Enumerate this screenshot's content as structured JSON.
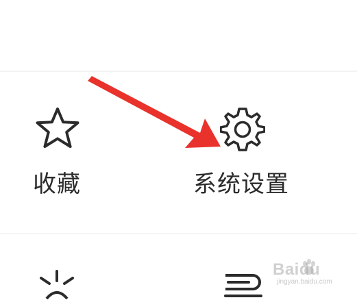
{
  "menu": {
    "items": [
      {
        "label": "收藏",
        "icon": "star-icon"
      },
      {
        "label": "系统设置",
        "icon": "gear-icon"
      },
      {
        "label": "",
        "icon": "brightness-icon"
      },
      {
        "label": "",
        "icon": "tray-icon"
      }
    ]
  },
  "annotation": {
    "arrow_color": "#e8322b"
  },
  "watermark": {
    "text": "Baidu",
    "subtext": "jingyan.baidu.com"
  }
}
